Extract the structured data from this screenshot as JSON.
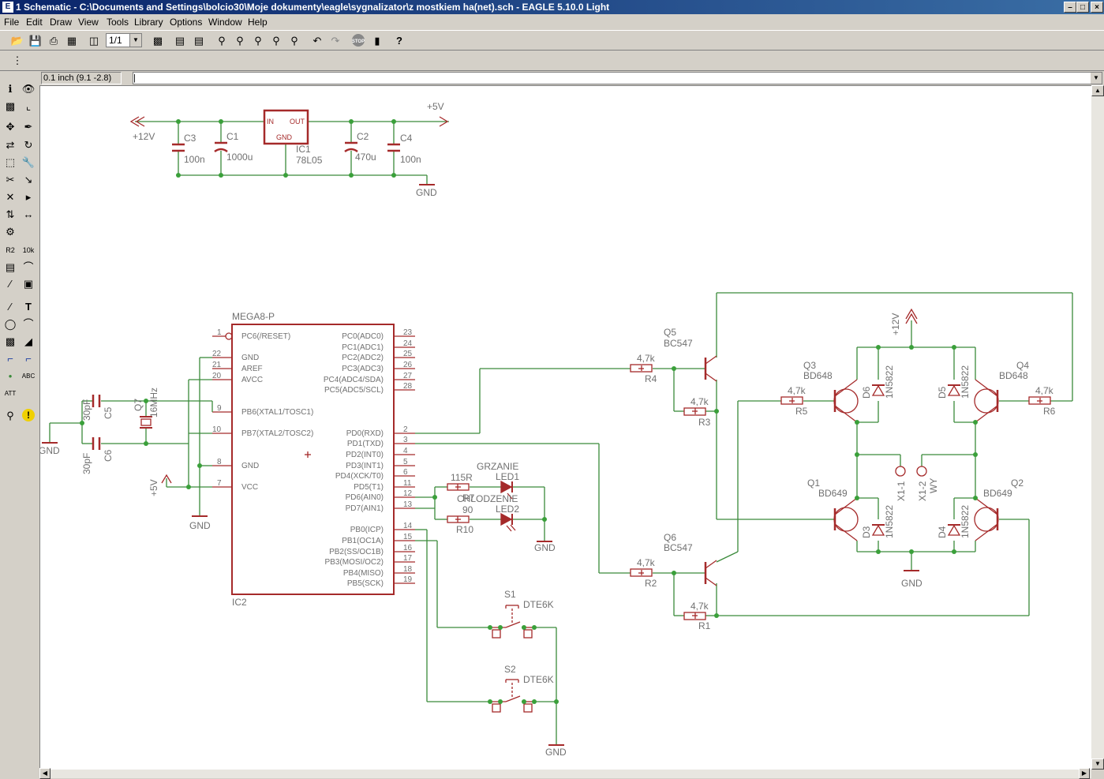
{
  "window": {
    "title": "1 Schematic - C:\\Documents and Settings\\bolcio30\\Moje dokumenty\\eagle\\sygnalizator\\z mostkiem ha(net).sch - EAGLE 5.10.0 Light",
    "minimize_icon": "minimize-icon",
    "maximize_icon": "maximize-icon",
    "close_icon": "close-icon"
  },
  "menu": [
    "File",
    "Edit",
    "Draw",
    "View",
    "Tools",
    "Library",
    "Options",
    "Window",
    "Help"
  ],
  "toolbar": {
    "sheet_value": "1/1",
    "stop_label": "STOP",
    "help_label": "?"
  },
  "status": {
    "grid_coordinate": "0.1 inch (9.1 -2.8)",
    "command_line": ""
  },
  "colors": {
    "symbol": "#a52a2a",
    "net": "#3a8a3a",
    "label": "#707070",
    "junction": "#3aa03a"
  },
  "schematic": {
    "power": {
      "ic1_name": "IC1",
      "ic1_value": "78L05",
      "ic1_in": "IN",
      "ic1_out": "OUT",
      "ic1_gnd": "GND",
      "c3_name": "C3",
      "c3_value": "100n",
      "c1_name": "C1",
      "c1_value": "1000u",
      "c2_name": "C2",
      "c2_value": "470u",
      "c4_name": "C4",
      "c4_value": "100n",
      "v12": "+12V",
      "v5": "+5V",
      "gnd": "GND"
    },
    "mcu": {
      "name": "IC2",
      "value": "MEGA8-P",
      "left_pins": [
        {
          "num": "1",
          "label": "PC6(/RESET)"
        },
        {
          "num": "22",
          "label": "GND"
        },
        {
          "num": "21",
          "label": "AREF"
        },
        {
          "num": "20",
          "label": "AVCC"
        },
        {
          "num": "9",
          "label": "PB6(XTAL1/TOSC1)"
        },
        {
          "num": "10",
          "label": "PB7(XTAL2/TOSC2)"
        },
        {
          "num": "8",
          "label": "GND"
        },
        {
          "num": "7",
          "label": "VCC"
        }
      ],
      "right_pins": [
        {
          "num": "23",
          "label": "PC0(ADC0)"
        },
        {
          "num": "24",
          "label": "PC1(ADC1)"
        },
        {
          "num": "25",
          "label": "PC2(ADC2)"
        },
        {
          "num": "26",
          "label": "PC3(ADC3)"
        },
        {
          "num": "27",
          "label": "PC4(ADC4/SDA)"
        },
        {
          "num": "28",
          "label": "PC5(ADC5/SCL)"
        },
        {
          "num": "2",
          "label": "PD0(RXD)"
        },
        {
          "num": "3",
          "label": "PD1(TXD)"
        },
        {
          "num": "4",
          "label": "PD2(INT0)"
        },
        {
          "num": "5",
          "label": "PD3(INT1)"
        },
        {
          "num": "6",
          "label": "PD4(XCK/T0)"
        },
        {
          "num": "11",
          "label": "PD5(T1)"
        },
        {
          "num": "12",
          "label": "PD6(AIN0)"
        },
        {
          "num": "13",
          "label": "PD7(AIN1)"
        },
        {
          "num": "14",
          "label": "PB0(ICP)"
        },
        {
          "num": "15",
          "label": "PB1(OC1A)"
        },
        {
          "num": "16",
          "label": "PB2(SS/OC1B)"
        },
        {
          "num": "17",
          "label": "PB3(MOSI/OC2)"
        },
        {
          "num": "18",
          "label": "PB4(MISO)"
        },
        {
          "num": "19",
          "label": "PB5(SCK)"
        }
      ]
    },
    "crystal": {
      "c5_name": "C5",
      "c5_value": "30pF",
      "c6_name": "C6",
      "c6_value": "30pF",
      "q7_name": "Q7",
      "q7_value": "16MHz",
      "gnd": "GND",
      "v5": "+5V"
    },
    "leds": {
      "r7_name": "R7",
      "r7_value": "115R",
      "r10_name": "R10",
      "r10_value": "90",
      "led1_name": "LED1",
      "led1_value": "GRZANIE",
      "led2_name": "LED2",
      "led2_value": "CHLODZENIE",
      "gnd": "GND"
    },
    "switches": {
      "s1_name": "S1",
      "s1_value": "DTE6K",
      "s2_name": "S2",
      "s2_value": "DTE6K",
      "gnd": "GND"
    },
    "bridge": {
      "q5_name": "Q5",
      "q5_value": "BC547",
      "q6_name": "Q6",
      "q6_value": "BC547",
      "q3_name": "Q3",
      "q3_value": "BD648",
      "q4_name": "Q4",
      "q4_value": "BD648",
      "q1_name": "Q1",
      "q1_value": "BD649",
      "q2_name": "Q2",
      "q2_value": "BD649",
      "r_value": "4,7k",
      "r1": "R1",
      "r2": "R2",
      "r3": "R3",
      "r4": "R4",
      "r5": "R5",
      "r6": "R6",
      "d_value": "1N5822",
      "d3": "D3",
      "d4": "D4",
      "d5": "D5",
      "d6": "D6",
      "x1_1": "X1-1",
      "x1_2": "X1-2",
      "wy": "WY",
      "v12": "+12V",
      "gnd": "GND"
    }
  }
}
